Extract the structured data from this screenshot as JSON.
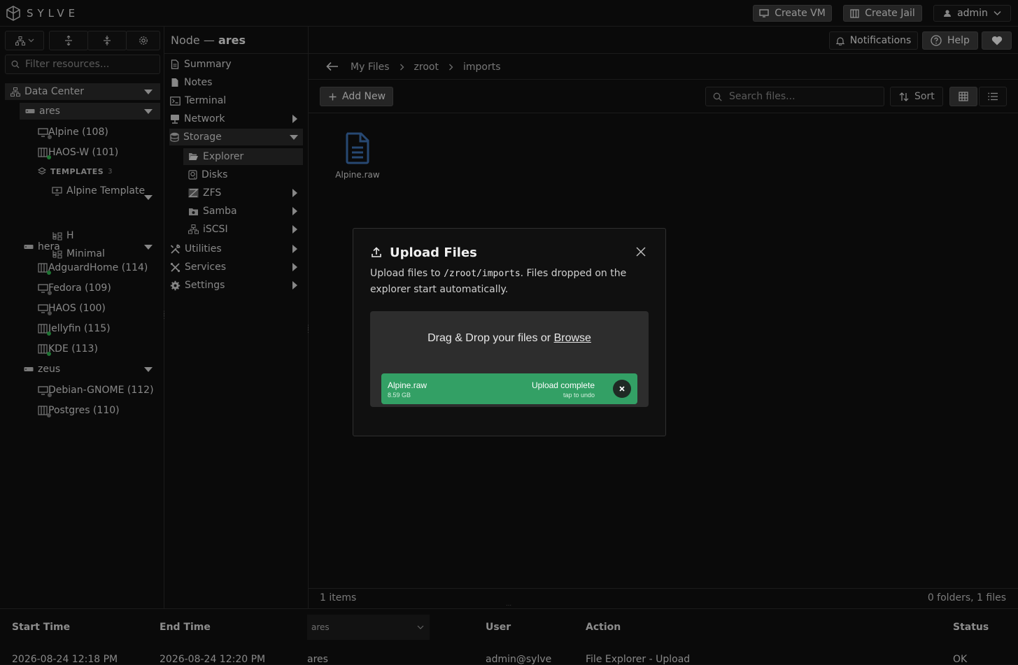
{
  "app": {
    "name": "SYLVE"
  },
  "topbar": {
    "create_vm": "Create VM",
    "create_jail": "Create Jail",
    "user": "admin"
  },
  "header": {
    "node_prefix": "Node —",
    "node_name": "ares",
    "notifications": "Notifications",
    "help": "Help"
  },
  "sidebar": {
    "filter_placeholder": "Filter resources...",
    "datacenter": "Data Center",
    "nodes": [
      {
        "name": "ares",
        "items": [
          {
            "label": "Alpine (108)",
            "kind": "vm",
            "status": "stopped"
          },
          {
            "label": "HAOS-W (101)",
            "kind": "jail",
            "status": "running"
          }
        ],
        "templates_label": "TEMPLATES",
        "templates_count": "3",
        "templates": [
          "Alpine Template",
          "H",
          "Minimal"
        ]
      },
      {
        "name": "hera",
        "items": [
          {
            "label": "AdguardHome (114)",
            "kind": "jail",
            "status": "running"
          },
          {
            "label": "Fedora (109)",
            "kind": "vm",
            "status": "stopped"
          },
          {
            "label": "HAOS (100)",
            "kind": "vm",
            "status": "stopped"
          },
          {
            "label": "Jellyfin (115)",
            "kind": "jail",
            "status": "running"
          },
          {
            "label": "KDE (113)",
            "kind": "jail",
            "status": "running"
          }
        ]
      },
      {
        "name": "zeus",
        "items": [
          {
            "label": "Debian-GNOME (112)",
            "kind": "vm",
            "status": "stopped"
          },
          {
            "label": "Postgres (110)",
            "kind": "jail",
            "status": "stopped"
          }
        ]
      }
    ]
  },
  "nav": {
    "summary": "Summary",
    "notes": "Notes",
    "terminal": "Terminal",
    "network": "Network",
    "storage": "Storage",
    "explorer": "Explorer",
    "disks": "Disks",
    "zfs": "ZFS",
    "samba": "Samba",
    "iscsi": "iSCSI",
    "utilities": "Utilities",
    "services": "Services",
    "settings": "Settings"
  },
  "explorer": {
    "breadcrumb": [
      "My Files",
      "zroot",
      "imports"
    ],
    "add_new": "Add New",
    "search_placeholder": "Search files...",
    "sort": "Sort",
    "files": [
      {
        "name": "Alpine.raw"
      }
    ],
    "footer_left": "1 items",
    "footer_right": "0 folders, 1 files"
  },
  "modal": {
    "title": "Upload Files",
    "desc_prefix": "Upload files to ",
    "path": "/zroot/imports",
    "desc_suffix": ". Files dropped on the explorer start automatically.",
    "drop_text": "Drag & Drop your files or ",
    "browse": "Browse",
    "file_name": "Alpine.raw",
    "file_size": "8.59 GB",
    "file_status": "Upload complete",
    "file_hint": "tap to undo"
  },
  "tasks": {
    "headers": {
      "start": "Start Time",
      "end": "End Time",
      "node_filter": "ares",
      "user": "User",
      "action": "Action",
      "status": "Status"
    },
    "rows": [
      {
        "start": "2026-08-24 12:18 PM",
        "end": "2026-08-24 12:20 PM",
        "node": "ares",
        "user": "admin@sylve",
        "action": "File Explorer - Upload",
        "status": "OK"
      }
    ]
  },
  "colors": {
    "running": "#2fb34e",
    "stopped": "#777777",
    "accent_upload": "#33a065",
    "file_icon": "#3d6fb0"
  }
}
